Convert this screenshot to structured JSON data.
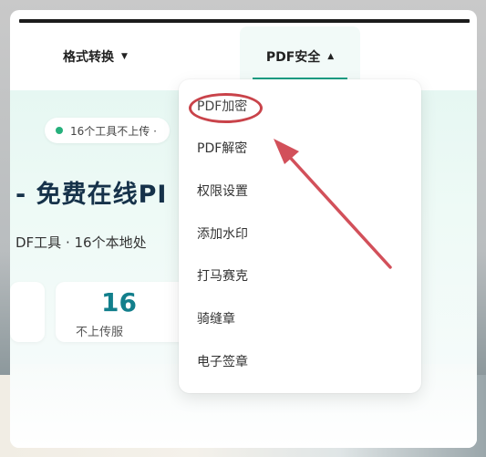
{
  "nav": {
    "format_convert": "格式转换",
    "format_arrow": "▼",
    "pdf_security": "PDF安全",
    "pdf_arrow": "▲"
  },
  "hero": {
    "badge_text": "16个工具不上传 ·",
    "headline": "- 免费在线PI",
    "subline": "DF工具 · 16个本地处",
    "stat_number": "16",
    "stat_label": "不上传服"
  },
  "dropdown": {
    "items": [
      {
        "label": "PDF加密"
      },
      {
        "label": "PDF解密"
      },
      {
        "label": "权限设置"
      },
      {
        "label": "添加水印"
      },
      {
        "label": "打马赛克"
      },
      {
        "label": "骑缝章"
      },
      {
        "label": "电子签章"
      }
    ]
  },
  "colors": {
    "accent": "#16a085",
    "annotation_red": "#c9434a",
    "heading": "#16324a"
  },
  "icons": [
    "status-dot-icon",
    "triangle-down-icon",
    "triangle-up-icon",
    "annotation-arrow-icon"
  ]
}
